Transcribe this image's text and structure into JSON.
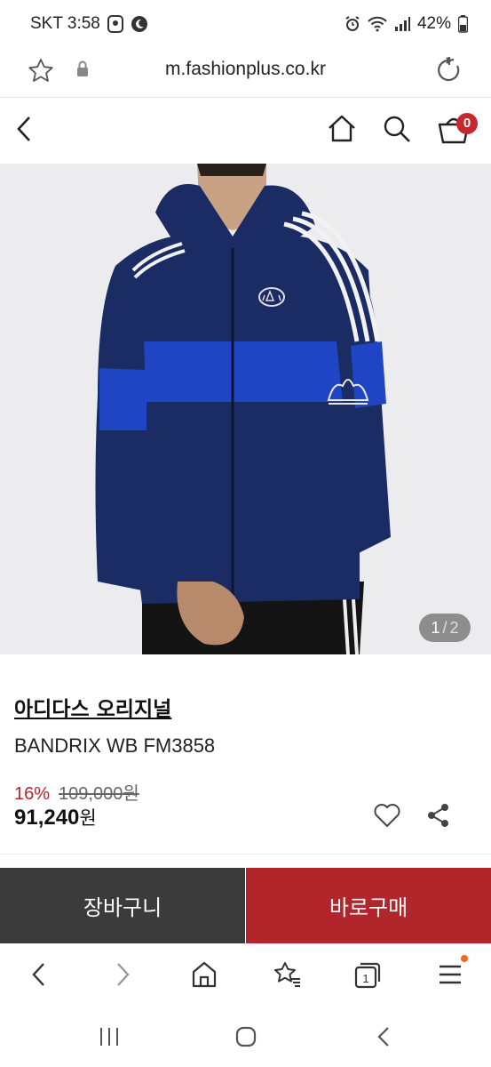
{
  "status_bar": {
    "carrier_time": "SKT 3:58",
    "battery": "42%"
  },
  "url_bar": {
    "url": "m.fashionplus.co.kr"
  },
  "header": {
    "cart_count": "0"
  },
  "product": {
    "image_counter_current": "1",
    "image_counter_sep": "/",
    "image_counter_total": "2",
    "brand": "아디다스 오리지널",
    "name": "BANDRIX WB FM3858",
    "discount": "16%",
    "original_price": "109,000원",
    "final_price_number": "91,240",
    "final_price_unit": "원"
  },
  "actions": {
    "cart_label": "장바구니",
    "buy_label": "바로구매"
  },
  "browser_nav": {
    "tabs_count": "1"
  },
  "colors": {
    "accent_red": "#b1262b",
    "cart_button": "#3b3b3b",
    "badge": "#c7282d",
    "jacket_navy": "#1b2b63",
    "jacket_blue": "#1f45c4"
  }
}
